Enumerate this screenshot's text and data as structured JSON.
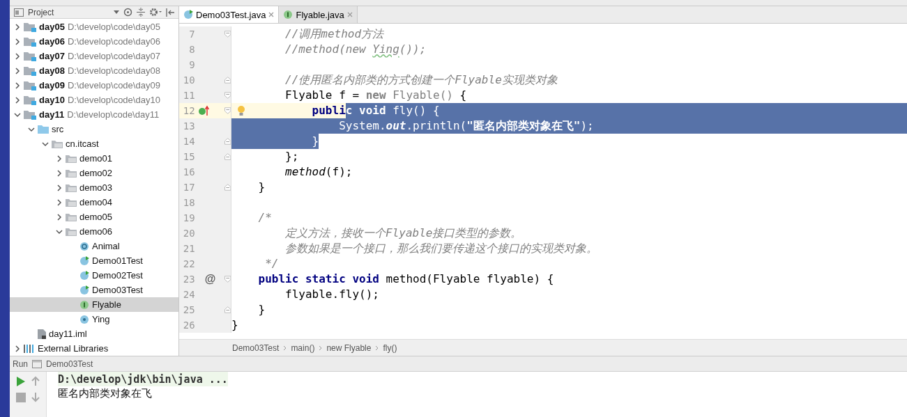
{
  "project": {
    "title": "Project",
    "tree": [
      {
        "label": "day05",
        "path": "D:\\develop\\code\\day05",
        "kind": "module",
        "expanded": false,
        "selected": false
      },
      {
        "label": "day06",
        "path": "D:\\develop\\code\\day06",
        "kind": "module",
        "expanded": false,
        "selected": false
      },
      {
        "label": "day07",
        "path": "D:\\develop\\code\\day07",
        "kind": "module",
        "expanded": false,
        "selected": false
      },
      {
        "label": "day08",
        "path": "D:\\develop\\code\\day08",
        "kind": "module",
        "expanded": false,
        "selected": false
      },
      {
        "label": "day09",
        "path": "D:\\develop\\code\\day09",
        "kind": "module",
        "expanded": false,
        "selected": false
      },
      {
        "label": "day10",
        "path": "D:\\develop\\code\\day10",
        "kind": "module",
        "expanded": false,
        "selected": false
      },
      {
        "label": "day11",
        "path": "D:\\develop\\code\\day11",
        "kind": "module",
        "expanded": true,
        "selected": false,
        "children": [
          {
            "label": "src",
            "kind": "source-folder",
            "expanded": true,
            "selected": false,
            "children": [
              {
                "label": "cn.itcast",
                "kind": "package",
                "expanded": true,
                "selected": false,
                "children": [
                  {
                    "label": "demo01",
                    "kind": "package",
                    "expanded": false,
                    "selected": false
                  },
                  {
                    "label": "demo02",
                    "kind": "package",
                    "expanded": false,
                    "selected": false
                  },
                  {
                    "label": "demo03",
                    "kind": "package",
                    "expanded": false,
                    "selected": false
                  },
                  {
                    "label": "demo04",
                    "kind": "package",
                    "expanded": false,
                    "selected": false
                  },
                  {
                    "label": "demo05",
                    "kind": "package",
                    "expanded": false,
                    "selected": false
                  },
                  {
                    "label": "demo06",
                    "kind": "package",
                    "expanded": true,
                    "selected": false,
                    "children": [
                      {
                        "label": "Animal",
                        "kind": "abstract-class",
                        "selected": false
                      },
                      {
                        "label": "Demo01Test",
                        "kind": "runnable-class",
                        "selected": false
                      },
                      {
                        "label": "Demo02Test",
                        "kind": "runnable-class",
                        "selected": false
                      },
                      {
                        "label": "Demo03Test",
                        "kind": "runnable-class",
                        "selected": false
                      },
                      {
                        "label": "Flyable",
                        "kind": "interface",
                        "selected": true
                      },
                      {
                        "label": "Ying",
                        "kind": "class",
                        "selected": false
                      }
                    ]
                  }
                ]
              }
            ]
          },
          {
            "label": "day11.iml",
            "kind": "module-file",
            "selected": false
          }
        ]
      },
      {
        "label": "External Libraries",
        "kind": "libraries",
        "expanded": false,
        "selected": false
      }
    ]
  },
  "tabs": [
    {
      "label": "Demo03Test.java",
      "kind": "runnable-class",
      "selected": true
    },
    {
      "label": "Flyable.java",
      "kind": "interface",
      "selected": false
    }
  ],
  "editor": {
    "lines": [
      {
        "number": "7",
        "fold_start": true,
        "tokens": [
          {
            "text": "        //调用method方法",
            "kind": "comment",
            "selected": false
          }
        ]
      },
      {
        "number": "8",
        "tokens": [
          {
            "text": "        //method(new ",
            "kind": "comment",
            "selected": false
          },
          {
            "text": "Ying",
            "kind": "comment-warning",
            "selected": false
          },
          {
            "text": "());",
            "kind": "comment",
            "selected": false
          }
        ]
      },
      {
        "number": "9"
      },
      {
        "number": "10",
        "fold_end": true,
        "tokens": [
          {
            "text": "        //使用匿名内部类的方式创建一个Flyable实现类对象",
            "kind": "comment",
            "selected": false
          }
        ]
      },
      {
        "number": "11",
        "fold_start": true,
        "tokens": [
          {
            "text": "        Flyable f = ",
            "kind": "plain",
            "selected": false
          },
          {
            "text": "new",
            "kind": "dim-keyword",
            "selected": false
          },
          {
            "text": " Flyable()",
            "kind": "dim",
            "selected": false
          },
          {
            "text": " {",
            "kind": "plain",
            "selected": false
          }
        ]
      },
      {
        "number": "12",
        "current": true,
        "fold_start": true,
        "implements_marker": true,
        "bulb": true,
        "selected_to_end": true,
        "tokens": [
          {
            "text": "            publi",
            "kind": "keyword",
            "selected": false
          },
          {
            "text": "c void",
            "kind": "keyword",
            "selected": true
          },
          {
            "text": " fly() {",
            "kind": "plain",
            "selected": true
          }
        ]
      },
      {
        "number": "13",
        "selected_to_end": true,
        "tokens": [
          {
            "text": "                System.",
            "kind": "plain",
            "selected": true
          },
          {
            "text": "out",
            "kind": "field",
            "selected": true
          },
          {
            "text": ".println(",
            "kind": "plain",
            "selected": true
          },
          {
            "text": "\"匿名内部类对象在飞\"",
            "kind": "string",
            "selected": true
          },
          {
            "text": ");",
            "kind": "plain",
            "selected": true
          }
        ]
      },
      {
        "number": "14",
        "fold_end": true,
        "tokens": [
          {
            "text": "            }",
            "kind": "plain",
            "selected": true
          }
        ]
      },
      {
        "number": "15",
        "fold_end": true,
        "tokens": [
          {
            "text": "        };",
            "kind": "plain",
            "selected": false
          }
        ]
      },
      {
        "number": "16",
        "tokens": [
          {
            "text": "        method",
            "kind": "call",
            "selected": false
          },
          {
            "text": "(f);",
            "kind": "plain",
            "selected": false
          }
        ]
      },
      {
        "number": "17",
        "fold_end": true,
        "tokens": [
          {
            "text": "    }",
            "kind": "plain",
            "selected": false
          }
        ]
      },
      {
        "number": "18"
      },
      {
        "number": "19",
        "tokens": [
          {
            "text": "    /*",
            "kind": "comment",
            "selected": false
          }
        ]
      },
      {
        "number": "20",
        "tokens": [
          {
            "text": "        定义方法，接收一个Flyable接口类型的参数。",
            "kind": "comment",
            "selected": false
          }
        ]
      },
      {
        "number": "21",
        "tokens": [
          {
            "text": "        参数如果是一个接口，那么我们要传递这个接口的实现类对象。",
            "kind": "comment",
            "selected": false
          }
        ]
      },
      {
        "number": "22",
        "tokens": [
          {
            "text": "     */",
            "kind": "comment",
            "selected": false
          }
        ]
      },
      {
        "number": "23",
        "fold_start": true,
        "gutter_mark": "@",
        "tokens": [
          {
            "text": "    public static void",
            "kind": "keyword",
            "selected": false
          },
          {
            "text": " method(Flyable flyable) {",
            "kind": "plain",
            "selected": false
          }
        ]
      },
      {
        "number": "24",
        "tokens": [
          {
            "text": "        flyable.fly();",
            "kind": "plain",
            "selected": false
          }
        ]
      },
      {
        "number": "25",
        "fold_end": true,
        "tokens": [
          {
            "text": "    }",
            "kind": "plain",
            "selected": false
          }
        ]
      },
      {
        "number": "26",
        "tokens": [
          {
            "text": "}",
            "kind": "plain",
            "selected": false
          }
        ]
      }
    ],
    "breadcrumbs": [
      "Demo03Test",
      "main()",
      "new Flyable",
      "fly()"
    ]
  },
  "run": {
    "title": "Run",
    "tab": "Demo03Test",
    "output": [
      {
        "text": "D:\\develop\\jdk\\bin\\java ...",
        "kind": "command"
      },
      {
        "text": "匿名内部类对象在飞",
        "kind": "stdout"
      }
    ]
  }
}
